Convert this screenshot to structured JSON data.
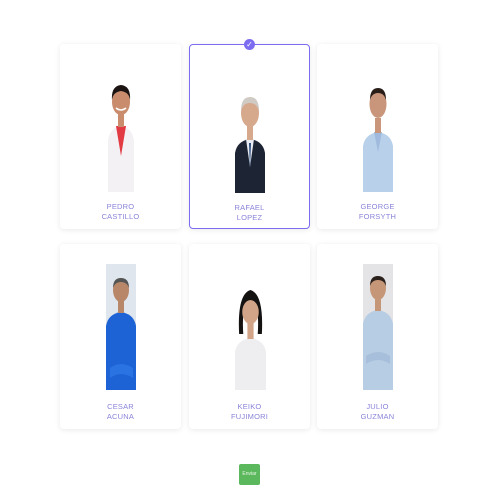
{
  "candidates": [
    {
      "first": "PEDRO",
      "last": "CASTILLO",
      "selected": false
    },
    {
      "first": "RAFAEL",
      "last": "LOPEZ",
      "selected": true
    },
    {
      "first": "GEORGE",
      "last": "FORSYTH",
      "selected": false
    },
    {
      "first": "CESAR",
      "last": "ACUNA",
      "selected": false
    },
    {
      "first": "KEIKO",
      "last": "FUJIMORI",
      "selected": false
    },
    {
      "first": "JULIO",
      "last": "GUZMAN",
      "selected": false
    }
  ],
  "selected_check_icon": "check-icon",
  "submit": {
    "label": "Enviar",
    "color": "#5cb85c"
  },
  "accent_color": "#7b6cf0"
}
